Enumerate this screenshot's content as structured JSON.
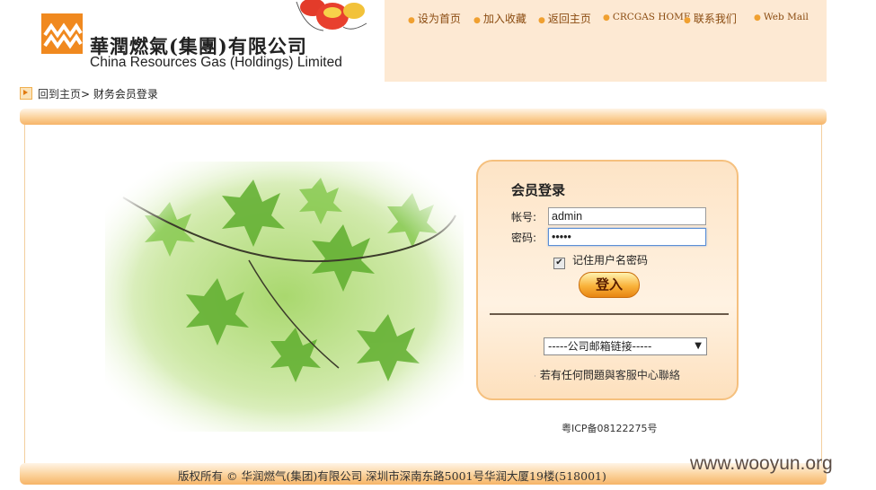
{
  "brand": {
    "name_cn": "華潤燃氣(集團)有限公司",
    "name_en": "China Resources Gas (Holdings) Limited"
  },
  "top_nav": [
    {
      "label": "设为首页"
    },
    {
      "label": "加入收藏"
    },
    {
      "label": "返回主页"
    },
    {
      "label": "CRCGAS HOME"
    },
    {
      "label": "联系我们"
    },
    {
      "label": "Web Mail"
    }
  ],
  "breadcrumb": {
    "home": "回到主页",
    "separator": ">",
    "current": "财务会员登录"
  },
  "login": {
    "title": "会员登录",
    "account_label": "帐号:",
    "account_value": "admin",
    "password_label": "密码:",
    "password_value": "•••••",
    "remember_label": "记住用户名密码",
    "remember_checked": true,
    "submit_label": "登入",
    "mail_select_value": "-----公司邮箱链接-----",
    "help_prefix": "若有任何問題與",
    "help_link": "客服中心聯絡"
  },
  "footer": {
    "icp": "粤ICP备08122275号",
    "copyright": "版权所有 © 华润燃气(集团)有限公司 深圳市深南东路5001号华润大厦19楼(518001)"
  },
  "watermark": "www.wooyun.org",
  "colors": {
    "brand_orange": "#f0891f",
    "nav_bg": "#fde9d3",
    "panel_border": "#f5c07e"
  }
}
